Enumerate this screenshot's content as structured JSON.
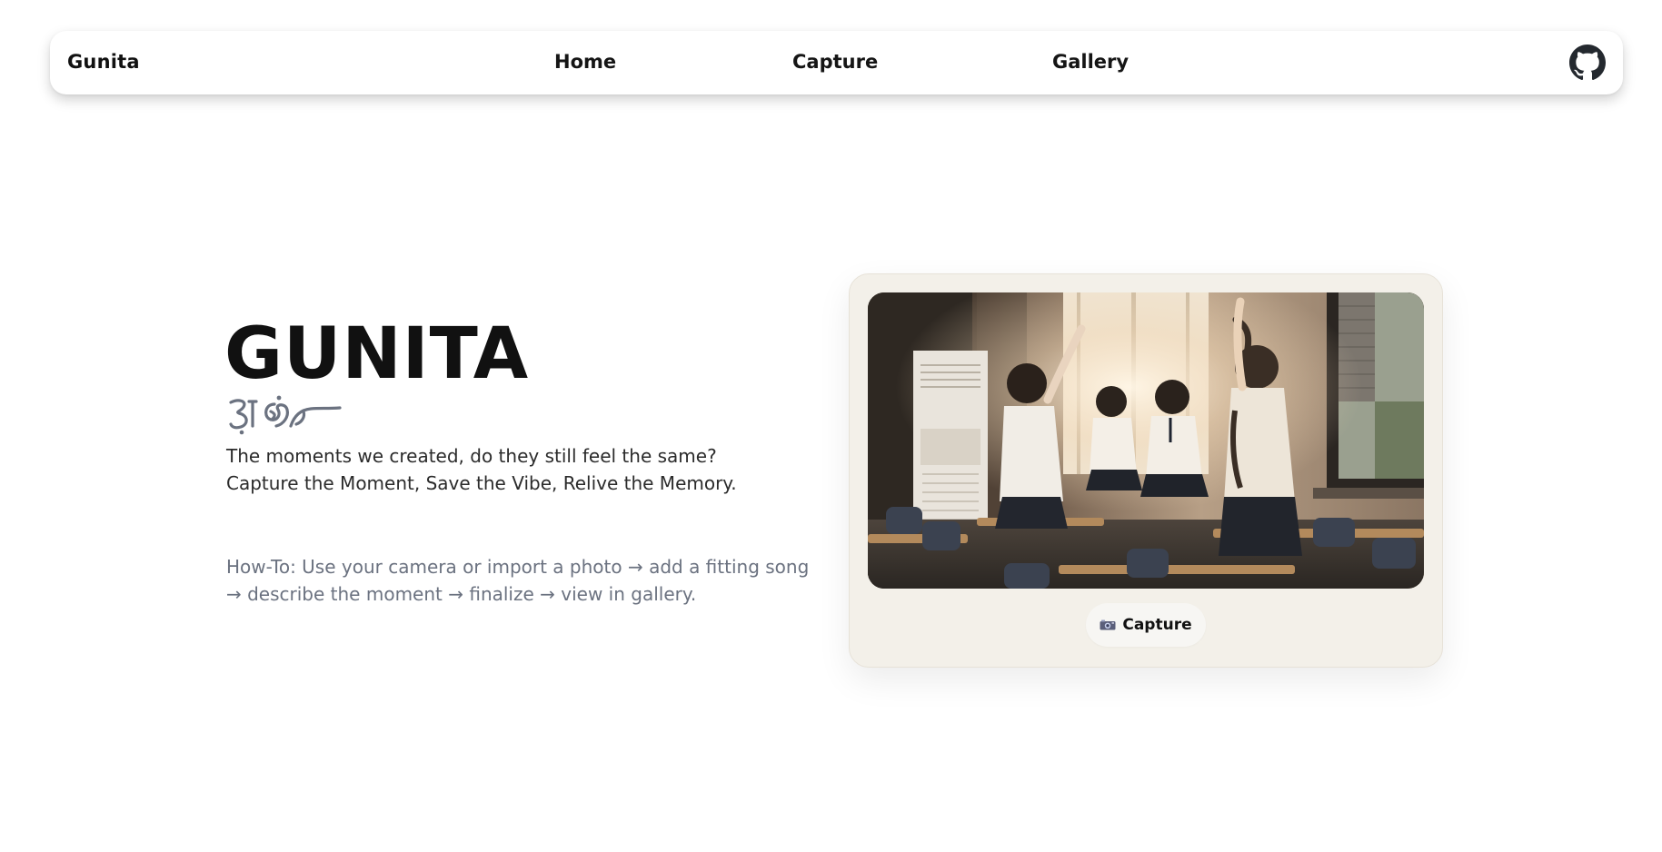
{
  "navbar": {
    "brand": "Gunita",
    "links": [
      "Home",
      "Capture",
      "Gallery"
    ],
    "github_icon": "github-icon"
  },
  "hero": {
    "title": "GUNITA",
    "script_icon": "baybayin-script-mark",
    "tagline_line1": "The moments we created, do they still feel the same?",
    "tagline_line2": "Capture the Moment, Save the Vibe, Relive the Memory.",
    "howto_line1": "How-To: Use your camera or import a photo → add a fitting song",
    "howto_line2": "→ describe the moment → finalize → view in gallery."
  },
  "card": {
    "capture_button_label": "Capture",
    "capture_icon": "camera-icon"
  },
  "colors": {
    "text": "#111111",
    "muted": "#6b7280",
    "card_bg": "#f3f0e9",
    "button_bg": "#f7f6f3"
  }
}
